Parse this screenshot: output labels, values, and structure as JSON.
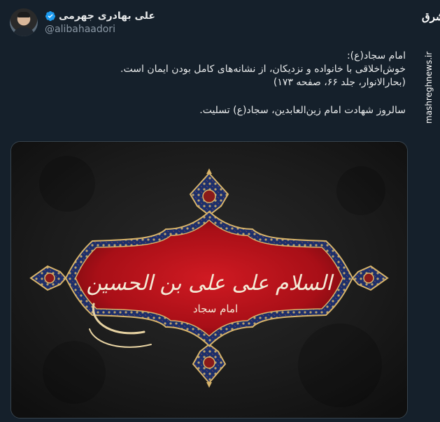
{
  "tweet": {
    "display_name": "علی بهادری جهرمی",
    "handle": "@alibahaadori",
    "lines": [
      "امام سجاد(ع):",
      "خوش‌اخلاقی با خانواده و نزدیکان، از نشانه‌های کامل بودن ایمان است.",
      "(بحارالانوار، جلد ۶۶، صفحه ۱۷۳)",
      "سالروز شهادت امام زین‌العابدین، سجاد(ع) تسلیت."
    ]
  },
  "icons": {
    "verified": "verified-badge-icon"
  },
  "media": {
    "calligraphy_main": "السلام علی علی بن الحسین",
    "calligraphy_sub": "امام سجاد",
    "colors": {
      "background": "#161616",
      "banner_red": "#b5121b",
      "ornament_blue": "#1d2f6b",
      "gold": "#d8b46a"
    }
  },
  "watermark": {
    "logo": "مشرق",
    "url": "mashreghnews.ir"
  },
  "colors": {
    "bg": "#15202b",
    "text": "#e7e9ea",
    "muted": "#8b98a5",
    "accent": "#1d9bf0"
  }
}
